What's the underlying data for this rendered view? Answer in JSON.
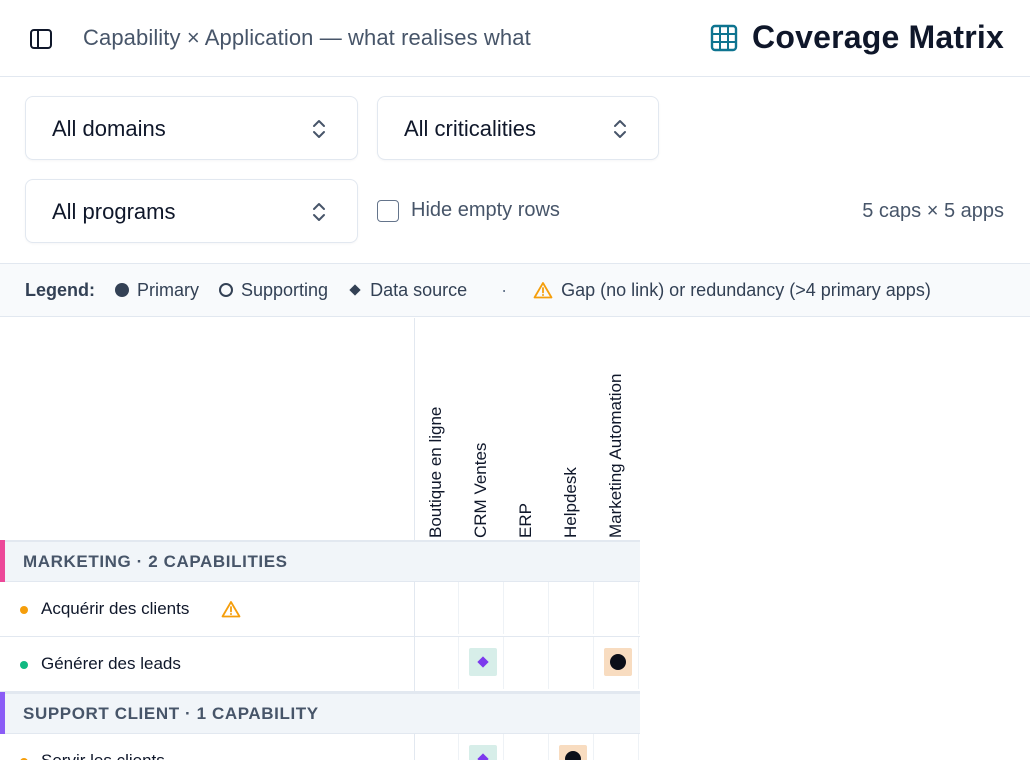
{
  "header": {
    "breadcrumb": "Capability × Application — what realises what",
    "title": "Coverage Matrix",
    "icons": {
      "sidebar": "sidebar-panel-icon",
      "title": "table-grid-icon"
    },
    "title_icon_color": "#0e7490"
  },
  "filters": {
    "domains": "All domains",
    "criticalities": "All criticalities",
    "programs": "All programs",
    "hide_empty_label": "Hide empty rows",
    "hide_empty_checked": false,
    "count": "5 caps × 5 apps"
  },
  "legend": {
    "title": "Legend:",
    "primary": "Primary",
    "supporting": "Supporting",
    "data_source": "Data source",
    "separator": "·",
    "gap": "Gap (no link) or redundancy (>4 primary apps)"
  },
  "matrix": {
    "applications": [
      "Boutique en ligne",
      "CRM Ventes",
      "ERP",
      "Helpdesk",
      "Marketing Automation"
    ],
    "groups": [
      {
        "label": "MARKETING · 2 CAPABILITIES",
        "color": "#ec4899",
        "capabilities": [
          {
            "name": "Acquérir des clients",
            "dot_color": "#f59e0b",
            "warning": true,
            "cells": [
              "",
              "",
              "",
              "",
              ""
            ]
          },
          {
            "name": "Générer des leads",
            "dot_color": "#10b981",
            "warning": false,
            "cells": [
              "",
              "data",
              "",
              "",
              "primary"
            ]
          }
        ]
      },
      {
        "label": "SUPPORT CLIENT · 1 CAPABILITY",
        "color": "#8b5cf6",
        "capabilities": [
          {
            "name": "Servir les clients",
            "dot_color": "#f59e0b",
            "warning": false,
            "cells": [
              "",
              "data",
              "",
              "primary",
              ""
            ]
          }
        ]
      }
    ]
  },
  "colors": {
    "warning": "#f59e0b",
    "data_source": "#7c3aed",
    "primary": "#0b0f19"
  }
}
